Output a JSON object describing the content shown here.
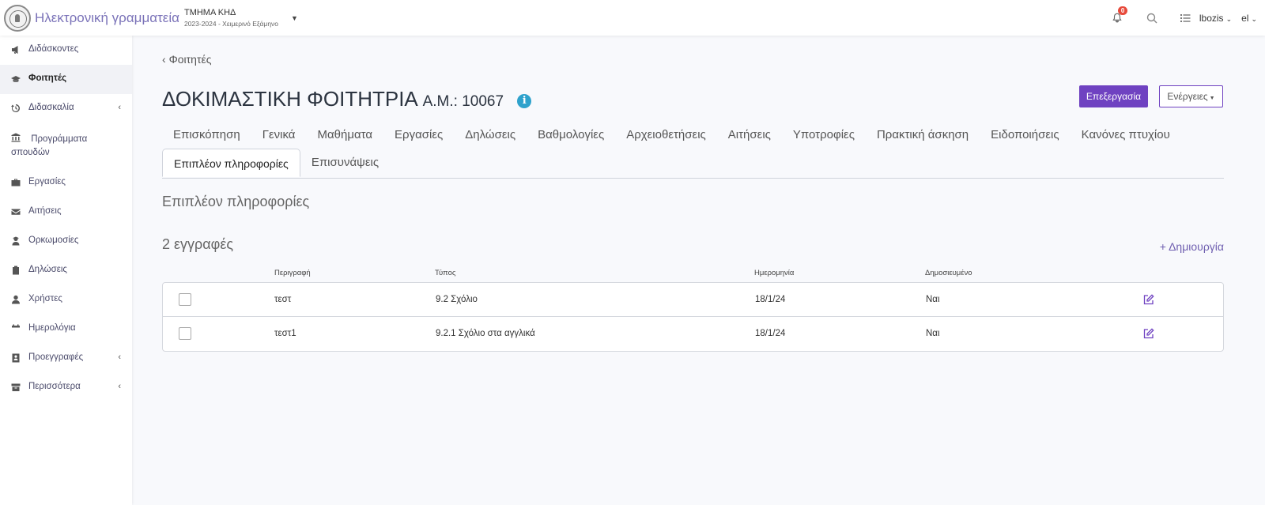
{
  "header": {
    "app_title": "Ηλεκτρονική γραμματεία",
    "department": "ΤΜΗΜΑ ΚΗΔ",
    "semester": "2023-2024 - Χειμερινό Εξάμηνο",
    "notifications_count": "0",
    "username": "lbozis",
    "language": "el"
  },
  "sidebar": {
    "items": [
      {
        "label": "Διδάσκοντες",
        "icon": "megaphone-icon"
      },
      {
        "label": "Φοιτητές",
        "icon": "graduation-cap-icon",
        "active": true
      },
      {
        "label": "Διδασκαλία",
        "icon": "history-icon",
        "expandable": true
      },
      {
        "label": "Προγράμματα σπουδών",
        "icon": "institution-icon"
      },
      {
        "label": "Εργασίες",
        "icon": "briefcase-icon"
      },
      {
        "label": "Αιτήσεις",
        "icon": "envelope-icon"
      },
      {
        "label": "Ορκωμοσίες",
        "icon": "user-graduate-icon"
      },
      {
        "label": "Δηλώσεις",
        "icon": "clipboard-icon"
      },
      {
        "label": "Χρήστες",
        "icon": "user-icon"
      },
      {
        "label": "Ημερολόγια",
        "icon": "calendar-icon"
      },
      {
        "label": "Προεγγραφές",
        "icon": "id-card-icon",
        "expandable": true
      },
      {
        "label": "Περισσότερα",
        "icon": "archive-icon",
        "expandable": true
      }
    ]
  },
  "page": {
    "back_label": "Φοιτητές",
    "student_name": "ΔΟΚΙΜΑΣΤΙΚΗ ΦΟΙΤΗΤΡΙΑ",
    "student_id": "Α.Μ.: 10067",
    "edit_button": "Επεξεργασία",
    "actions_button": "Ενέργειες",
    "tabs_row1": [
      "Επισκόπηση",
      "Γενικά",
      "Μαθήματα",
      "Εργασίες",
      "Δηλώσεις",
      "Βαθμολογίες",
      "Αρχειοθετήσεις",
      "Αιτήσεις",
      "Υποτροφίες",
      "Πρακτική άσκηση",
      "Ειδοποιήσεις",
      "Κανόνες πτυχίου"
    ],
    "tabs_row2": [
      "Επιπλέον πληροφορίες",
      "Επισυνάψεις"
    ],
    "active_tab": "Επιπλέον πληροφορίες",
    "section_title": "Επιπλέον πληροφορίες",
    "record_count": "2 εγγραφές",
    "create_label": "+ Δημιουργία"
  },
  "table": {
    "columns": [
      "Περιγραφή",
      "Τύπος",
      "Ημερομηνία",
      "Δημοσιευμένο"
    ],
    "rows": [
      {
        "description": "τεστ",
        "type": "9.2 Σχόλιο",
        "date": "18/1/24",
        "published": "Ναι"
      },
      {
        "description": "τεστ1",
        "type": "9.2.1 Σχόλιο στα αγγλικά",
        "date": "18/1/24",
        "published": "Ναι"
      }
    ]
  },
  "colors": {
    "primary": "#6f42c1",
    "info": "#2ea2cc",
    "badge": "#e74a3b"
  }
}
